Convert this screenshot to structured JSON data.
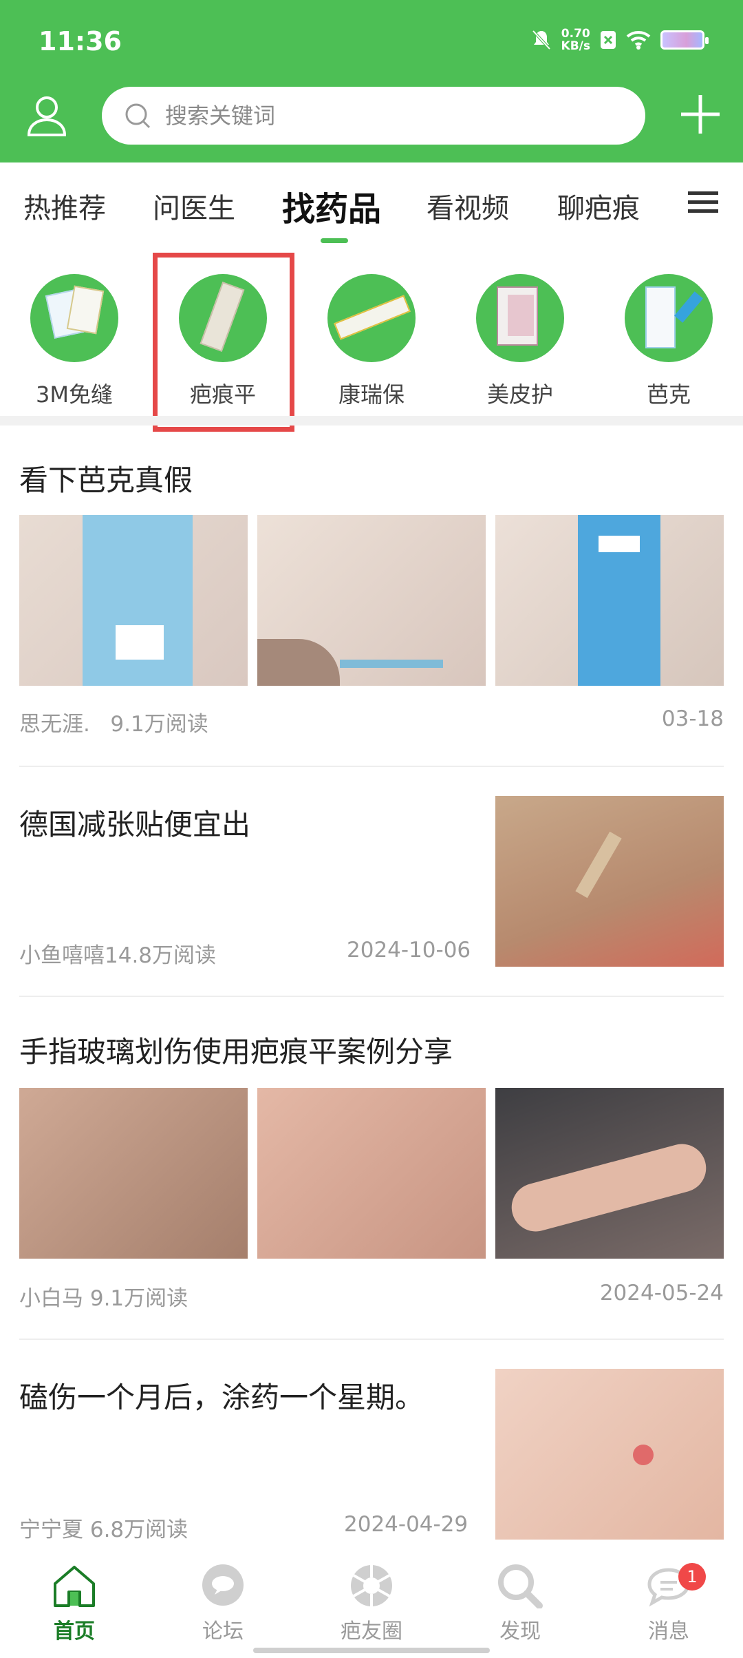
{
  "status_bar": {
    "time": "11:36",
    "net_speed_value": "0.70",
    "net_speed_unit": "KB/s"
  },
  "search": {
    "placeholder": "搜索关键词"
  },
  "tabs": [
    {
      "label": "热推荐"
    },
    {
      "label": "问医生"
    },
    {
      "label": "找药品"
    },
    {
      "label": "看视频"
    },
    {
      "label": "聊疤痕"
    }
  ],
  "categories": [
    {
      "label": "3M免缝"
    },
    {
      "label": "疤痕平"
    },
    {
      "label": "康瑞保"
    },
    {
      "label": "美皮护"
    },
    {
      "label": "芭克"
    }
  ],
  "posts": [
    {
      "title": "看下芭克真假",
      "author": "思无涯.",
      "reads": "9.1万阅读",
      "date": "03-18"
    },
    {
      "title": "德国减张贴便宜出",
      "author_reads": "小鱼嘻嘻14.8万阅读",
      "date": "2024-10-06"
    },
    {
      "title": "手指玻璃划伤使用疤痕平案例分享",
      "author_reads": "小白马 9.1万阅读",
      "date": "2024-05-24"
    },
    {
      "title": "磕伤一个月后，涂药一个星期。",
      "author_reads": "宁宁夏 6.8万阅读",
      "date": "2024-04-29"
    }
  ],
  "bottom_nav": [
    {
      "label": "首页"
    },
    {
      "label": "论坛"
    },
    {
      "label": "疤友圈"
    },
    {
      "label": "发现"
    },
    {
      "label": "消息",
      "badge": "1"
    }
  ],
  "colors": {
    "brand_green": "#4dbf55",
    "highlight_red": "#e54848",
    "badge_red": "#f04848"
  }
}
